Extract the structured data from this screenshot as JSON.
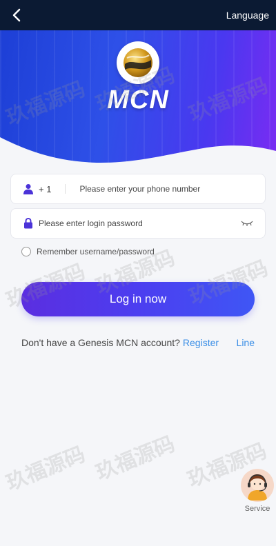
{
  "header": {
    "language_label": "Language",
    "back_icon": "chevron-left-icon"
  },
  "brand": {
    "logo_text": "MCN"
  },
  "phone_field": {
    "country_code": "+ 1",
    "placeholder": "Please enter your phone number",
    "value": ""
  },
  "password_field": {
    "placeholder": "Please enter login password",
    "value": ""
  },
  "remember": {
    "label": "Remember username/password",
    "checked": false
  },
  "login_button": {
    "label": "Log in now"
  },
  "signup": {
    "prompt": "Don't have a Genesis MCN account?",
    "register_label": "Register",
    "line_label": "Line"
  },
  "service": {
    "label": "Service"
  },
  "watermark": {
    "text": "玖福源码"
  },
  "colors": {
    "topbar": "#0b1a33",
    "accent_blue": "#3a8ee6",
    "button_start": "#5b2ee0",
    "button_end": "#3f56f5",
    "icon_purple": "#4b33d8"
  }
}
